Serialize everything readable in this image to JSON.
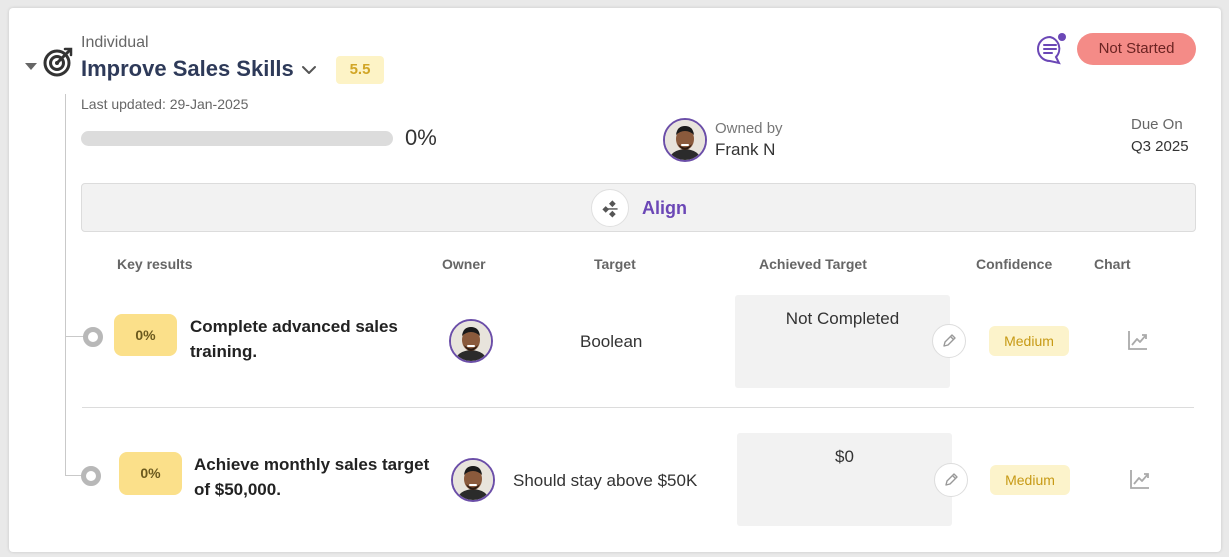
{
  "objective": {
    "type_label": "Individual",
    "title": "Improve Sales Skills",
    "score": "5.5",
    "last_updated": "Last updated: 29-Jan-2025",
    "progress_text": "0%",
    "progress_value": 0,
    "owned_by_label": "Owned by",
    "owner_name": "Frank N",
    "due_label": "Due On",
    "due_value": "Q3 2025",
    "status": "Not Started",
    "align_label": "Align"
  },
  "columns": {
    "key_results": "Key results",
    "owner": "Owner",
    "target": "Target",
    "achieved": "Achieved Target",
    "confidence": "Confidence",
    "chart": "Chart"
  },
  "key_results": [
    {
      "progress": "0%",
      "title": "Complete advanced sales training.",
      "target": "Boolean",
      "achieved": "Not Completed",
      "confidence": "Medium"
    },
    {
      "progress": "0%",
      "title": "Achieve monthly sales target of $50,000.",
      "target": "Should stay above $50K",
      "achieved": "$0",
      "confidence": "Medium"
    }
  ],
  "colors": {
    "accent": "#6b47b6",
    "status_bg": "#f48b87",
    "score_bg": "#fdf3c6",
    "badge_bg": "#fbe08a"
  },
  "icons": [
    "target-icon",
    "chevron-down-icon",
    "chat-icon",
    "align-icon",
    "edit-icon",
    "trend-chart-icon"
  ]
}
